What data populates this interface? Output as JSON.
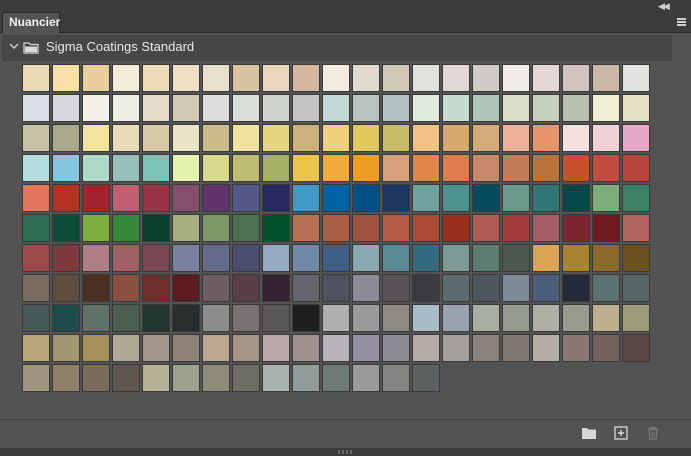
{
  "panel": {
    "tab_label": "Nuancier",
    "group_title": "Sigma Coatings Standard",
    "icons": {
      "collapse": "double-chevron-left-icon",
      "menu": "hamburger-menu-icon",
      "new_group": "folder-icon",
      "new_swatch": "add-swatch-icon",
      "delete": "trash-icon"
    }
  },
  "swatches": [
    [
      "#e9d9b5",
      "#f9dfa8",
      "#e6cd99",
      "#f4ecd6",
      "#eedbb7",
      "#eedfc2",
      "#e6e0cc",
      "#d7c3a3",
      "#ead6bd",
      "#d4b79e",
      "#f5ebde",
      "#e1d9cd",
      "#d2c8b8",
      "#e1e0dd",
      "#e0d8d5",
      "#cfcbc7",
      "#f1ede8",
      "#e3d7d7",
      "#d2c3c1",
      "#cbb7a7",
      "#e2e2e0"
    ],
    [
      "#dcdfe6",
      "#d7d6dc",
      "#f2f0e6",
      "#efefe3",
      "#e4dcc9",
      "#d3cab4",
      "#dcdcdb",
      "#d9ded7",
      "#cfd3cd",
      "#c2c5c3",
      "#c2d9d6",
      "#b6c3c0",
      "#b2c2c1",
      "#e0edde",
      "#c5ddcf",
      "#aec7b9",
      "#d8ddc6",
      "#c7d1be",
      "#b9c0ad",
      "#efefd4",
      "#e5e1c2"
    ],
    [
      "#c5c2a6",
      "#a8a88b",
      "#f0e49e",
      "#e8dbb7",
      "#d8caa8",
      "#ebe3c5",
      "#cbbb8a",
      "#f1e19e",
      "#e3d47e",
      "#cbb27c",
      "#efd07a",
      "#e1c85e",
      "#c8bc69",
      "#f1c185",
      "#d8a96e",
      "#d5a978",
      "#ecb097",
      "#e9946c",
      "#f5e0e0",
      "#f2d0d8",
      "#e6a9c5"
    ],
    [
      "#b4dde2",
      "#86c4df",
      "#b1dac8",
      "#94c0b8",
      "#7ec4b5",
      "#e3f2ac",
      "#d7da8d",
      "#bcbc73",
      "#a4ae66",
      "#ecc448",
      "#f0a93b",
      "#ec9d22",
      "#d6a27b",
      "#e0884a",
      "#e17c4d",
      "#c7896a",
      "#c27c59",
      "#b9743c",
      "#c6502a",
      "#c24c3f",
      "#b8463f"
    ],
    [
      "#e4765d",
      "#b53222",
      "#a2222d",
      "#bf6070",
      "#9a3345",
      "#874f6e",
      "#60346d",
      "#545989",
      "#28295e",
      "#3f9ac6",
      "#0164a1",
      "#044f86",
      "#1c3561",
      "#6fa39d",
      "#4d9291",
      "#044c5b",
      "#6b9a8c",
      "#327778",
      "#02484a",
      "#7cae7c",
      "#3d8265"
    ],
    [
      "#2f6d52",
      "#0e4c3a",
      "#7caf3e",
      "#36893b",
      "#0a3e2e",
      "#a6af7d",
      "#7d9768",
      "#4f7152",
      "#02512d",
      "#b77155",
      "#a95e47",
      "#a05340",
      "#b45c45",
      "#ac4a36",
      "#9a2f1d",
      "#b05d55",
      "#a33c3a",
      "#a55d67",
      "#7e2532",
      "#6c1a1f",
      "#b26460"
    ],
    [
      "#9b4b4a",
      "#7d3b3e",
      "#b17e86",
      "#9d6164",
      "#7c4653",
      "#7a809f",
      "#646b8c",
      "#4a4c70",
      "#95aac3",
      "#7089a7",
      "#3f5f86",
      "#87aab2",
      "#5a8b94",
      "#356b7f",
      "#7d9b94",
      "#5c7d72",
      "#4e574e",
      "#d9a552",
      "#a78530",
      "#8c6a2a",
      "#6d5020"
    ],
    [
      "#7a6c5f",
      "#5e4c3e",
      "#4b3024",
      "#8a5040",
      "#702e2d",
      "#5c1c20",
      "#6e5b64",
      "#5a3f46",
      "#352230",
      "#64656c",
      "#4f5360",
      "#8b8a96",
      "#595258",
      "#3b3a40",
      "#5c6b6e",
      "#4e5660",
      "#7d8a99",
      "#4b5f7b",
      "#232b3b",
      "#5c7172",
      "#566666"
    ],
    [
      "#465858",
      "#1e4a4b",
      "#5e7268",
      "#4a5e52",
      "#243632",
      "#282d2d",
      "#8c8d8d",
      "#767272",
      "#5a5757",
      "#1f1f1f",
      "#b0b0ae",
      "#9c9b9c",
      "#8e8b85",
      "#a9bbc6",
      "#9aa2b0",
      "#a7ada3",
      "#969b92",
      "#adb0a3",
      "#999a90",
      "#bdb08f",
      "#9a9b78"
    ],
    [
      "#b8a67c",
      "#a19872",
      "#a58f5a",
      "#b2a896",
      "#a2968a",
      "#8e8279",
      "#bca591",
      "#a89388",
      "#bba8a8",
      "#a09191",
      "#b8b2ba",
      "#948fa1",
      "#8b8a95",
      "#b6aaa7",
      "#a6a09d",
      "#8c837d",
      "#7f7770",
      "#b4ada3",
      "#897674",
      "#75615d",
      "#5c4a46"
    ],
    [
      "#a0957e",
      "#8e8069",
      "#7a6c5c",
      "#5f564d",
      "#b4b195",
      "#9ba18c",
      "#8b8b76",
      "#6e6e64",
      "#a8b3b0",
      "#909c99",
      "#6e7b78",
      "#9a9c99",
      "#838683",
      "#5b6261"
    ]
  ]
}
